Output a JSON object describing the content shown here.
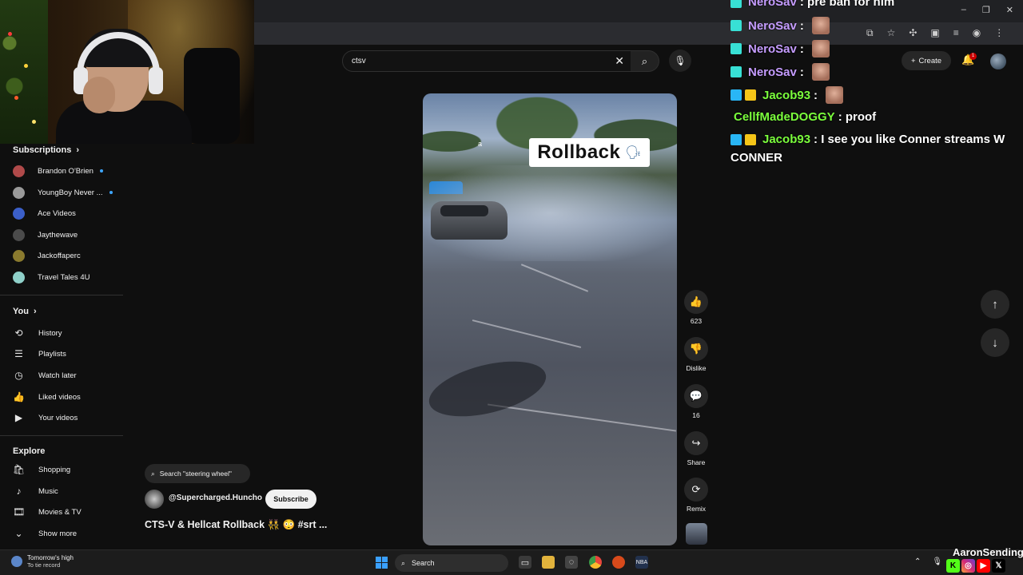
{
  "browser": {
    "window_controls": [
      "–",
      "❐",
      "✕"
    ]
  },
  "search": {
    "query": "ctsv",
    "clear_icon": "close-icon",
    "search_icon": "search-icon",
    "mic_icon": "mic-icon"
  },
  "header": {
    "create_label": "Create",
    "notification_count": "1"
  },
  "sidebar": {
    "subscriptions_title": "Subscriptions",
    "subscriptions": [
      {
        "label": "Brandon O'Brien",
        "color": "#b04a4a",
        "new": true
      },
      {
        "label": "YoungBoy Never ...",
        "color": "#9a9a9a",
        "new": true
      },
      {
        "label": "Ace Videos",
        "color": "#3b5fc9",
        "new": false
      },
      {
        "label": "Jaythewave",
        "color": "#4b4b4b",
        "new": false
      },
      {
        "label": "Jackoffaperc",
        "color": "#8a7a2e",
        "new": false
      },
      {
        "label": "Travel Tales 4U",
        "color": "#8fd0c9",
        "new": false
      }
    ],
    "you_title": "You",
    "you_items": [
      {
        "label": "History",
        "icon": "history-icon",
        "glyph": "⟲"
      },
      {
        "label": "Playlists",
        "icon": "playlists-icon",
        "glyph": "☰"
      },
      {
        "label": "Watch later",
        "icon": "watch-later-icon",
        "glyph": "◷"
      },
      {
        "label": "Liked videos",
        "icon": "thumbs-up-icon",
        "glyph": "👍"
      },
      {
        "label": "Your videos",
        "icon": "your-videos-icon",
        "glyph": "▶"
      }
    ],
    "explore_title": "Explore",
    "explore_items": [
      {
        "label": "Shopping",
        "icon": "shopping-icon",
        "glyph": "🛍"
      },
      {
        "label": "Music",
        "icon": "music-icon",
        "glyph": "♪"
      },
      {
        "label": "Movies & TV",
        "icon": "movies-icon",
        "glyph": "🎞"
      },
      {
        "label": "Show more",
        "icon": "chevron-down-icon",
        "glyph": "⌄"
      }
    ]
  },
  "video": {
    "overlay_caption": "Rollback",
    "overlay_small": "a",
    "search_chip": "Search \"steering wheel\"",
    "channel": "@Supercharged.Huncho",
    "subscribe_label": "Subscribe",
    "title": "CTS-V & Hellcat Rollback 👯 😳 #srt ...",
    "actions": [
      {
        "name": "like",
        "label": "623",
        "glyph": "👍"
      },
      {
        "name": "dislike",
        "label": "Dislike",
        "glyph": "👎"
      },
      {
        "name": "comments",
        "label": "16",
        "glyph": "💬"
      },
      {
        "name": "share",
        "label": "Share",
        "glyph": "↪"
      },
      {
        "name": "remix",
        "label": "Remix",
        "glyph": "⟳"
      }
    ]
  },
  "navigation": {
    "up_icon": "arrow-up-icon",
    "down_icon": "arrow-down-icon"
  },
  "chat": [
    {
      "user": "NeroSav",
      "color": "#c59cff",
      "text": ": pre ban for him",
      "emote": false,
      "badges": [
        "#38e0d5"
      ]
    },
    {
      "user": "NeroSav",
      "color": "#c59cff",
      "text": ":",
      "emote": true,
      "badges": [
        "#38e0d5"
      ]
    },
    {
      "user": "NeroSav",
      "color": "#c59cff",
      "text": ":",
      "emote": true,
      "badges": [
        "#38e0d5"
      ]
    },
    {
      "user": "NeroSav",
      "color": "#c59cff",
      "text": ":",
      "emote": true,
      "badges": [
        "#38e0d5"
      ]
    },
    {
      "user": "Jacob93",
      "color": "#7bff3c",
      "text": ":",
      "emote": true,
      "badges": [
        "#29b6f6",
        "#f5c518"
      ]
    },
    {
      "user": "CellfMadeDOGGY",
      "color": "#7bff3c",
      "text": ": proof",
      "emote": false,
      "badges": []
    },
    {
      "user": "Jacob93",
      "color": "#7bff3c",
      "text": ": I see you like Conner streams W",
      "emote": false,
      "badges": [
        "#29b6f6",
        "#f5c518"
      ]
    }
  ],
  "chat_continuation": "CONNER",
  "taskbar": {
    "weather_line1": "Tomorrow's high",
    "weather_line2": "To tie record",
    "search_label": "Search"
  },
  "overlay": {
    "streamer": "AaronSending"
  }
}
